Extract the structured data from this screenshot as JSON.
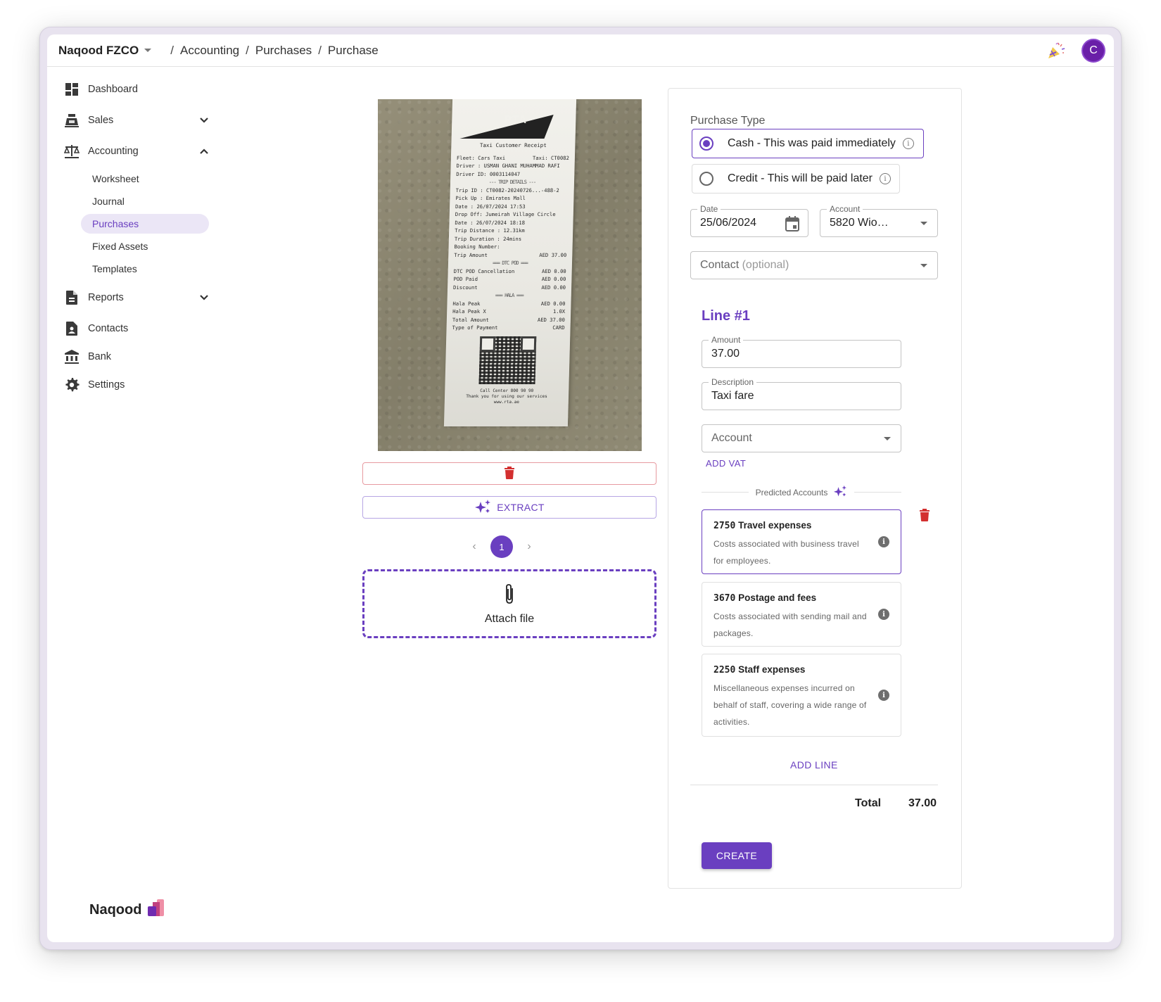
{
  "topbar": {
    "org_name": "Naqood FZCO",
    "breadcrumbs": [
      "Accounting",
      "Purchases",
      "Purchase"
    ],
    "avatar_initial": "C",
    "party_icon": "party-popper-icon"
  },
  "sidebar": {
    "items": [
      {
        "label": "Dashboard",
        "icon": "dashboard-icon"
      },
      {
        "label": "Sales",
        "icon": "cash-register-icon",
        "expandable": true,
        "expanded": false
      },
      {
        "label": "Accounting",
        "icon": "scale-icon",
        "expandable": true,
        "expanded": true
      },
      {
        "label": "Reports",
        "icon": "document-icon",
        "expandable": true,
        "expanded": false
      },
      {
        "label": "Contacts",
        "icon": "contact-card-icon"
      },
      {
        "label": "Bank",
        "icon": "bank-icon"
      },
      {
        "label": "Settings",
        "icon": "gear-icon"
      }
    ],
    "accounting_subitems": [
      {
        "label": "Worksheet",
        "active": false
      },
      {
        "label": "Journal",
        "active": false
      },
      {
        "label": "Purchases",
        "active": true
      },
      {
        "label": "Fixed Assets",
        "active": false
      },
      {
        "label": "Templates",
        "active": false
      }
    ],
    "brand": "Naqood"
  },
  "attachment": {
    "receipt": {
      "logo": "RTA",
      "title": "Taxi Customer Receipt",
      "lines": [
        [
          "Fleet: Cars Taxi",
          "Taxi: CT0082"
        ],
        [
          "Driver : USMAN GHANI MUHAMMAD RAFI",
          ""
        ],
        [
          "Driver ID: 0003114047",
          ""
        ],
        [
          "--- TRIP DETAILS ---",
          ""
        ],
        [
          "Trip ID : CT0082-20240726...-488-2",
          ""
        ],
        [
          "Pick Up : Emirates Mall",
          ""
        ],
        [
          "Date : 26/07/2024 17:53",
          ""
        ],
        [
          "Drop Off: Jumeirah Village Circle",
          ""
        ],
        [
          "Date : 26/07/2024 18:18",
          ""
        ],
        [
          "Trip Distance : 12.31km",
          ""
        ],
        [
          "Trip Duration : 24mins",
          ""
        ],
        [
          "Booking Number:",
          ""
        ],
        [
          "Trip Amount",
          "AED 37.00"
        ],
        [
          "=== DTC POD ===",
          ""
        ],
        [
          "DTC POD Cancellation",
          "AED 0.00"
        ],
        [
          "POD Paid",
          "AED 0.00"
        ],
        [
          "Discount",
          "AED 0.00"
        ],
        [
          "=== HALA ===",
          ""
        ],
        [
          "Hala Peak",
          "AED 0.00"
        ],
        [
          "Hala Peak X",
          "1.0X"
        ],
        [
          "Total Amount",
          "AED 37.00"
        ],
        [
          "Type of Payment",
          "CARD"
        ]
      ],
      "footer": [
        "Call Center 800 90 90",
        "Thank you for using our services",
        "www.rta.ae"
      ]
    },
    "extract_label": "EXTRACT",
    "current_page": "1",
    "attach_label": "Attach file"
  },
  "form": {
    "purchase_type_label": "Purchase Type",
    "purchase_types": [
      {
        "label": "Cash - This was paid immediately",
        "selected": true
      },
      {
        "label": "Credit - This will be paid later",
        "selected": false
      }
    ],
    "date": {
      "label": "Date",
      "value": "25/06/2024"
    },
    "account": {
      "label": "Account",
      "value": "5820 Wio…"
    },
    "contact": {
      "placeholder": "Contact",
      "placeholder_suffix": "(optional)"
    },
    "line": {
      "title": "Line #1",
      "amount_label": "Amount",
      "amount_value": "37.00",
      "description_label": "Description",
      "description_value": "Taxi fare",
      "account_placeholder": "Account",
      "add_vat_label": "ADD VAT",
      "predicted_label": "Predicted Accounts",
      "predicted_accounts": [
        {
          "code": "2750",
          "name": "Travel expenses",
          "description": "Costs associated with business travel for employees.",
          "selected": true
        },
        {
          "code": "3670",
          "name": "Postage and fees",
          "description": "Costs associated with sending mail and packages.",
          "selected": false
        },
        {
          "code": "2250",
          "name": "Staff expenses",
          "description": "Miscellaneous expenses incurred on behalf of staff, covering a wide range of activities.",
          "selected": false
        }
      ]
    },
    "add_line_label": "ADD LINE",
    "total_label": "Total",
    "total_value": "37.00",
    "create_label": "CREATE"
  },
  "colors": {
    "accent": "#6a3fc0",
    "danger": "#d32f2f",
    "active_bg": "#ebe6f6",
    "avatar": "#6a1fa8"
  }
}
